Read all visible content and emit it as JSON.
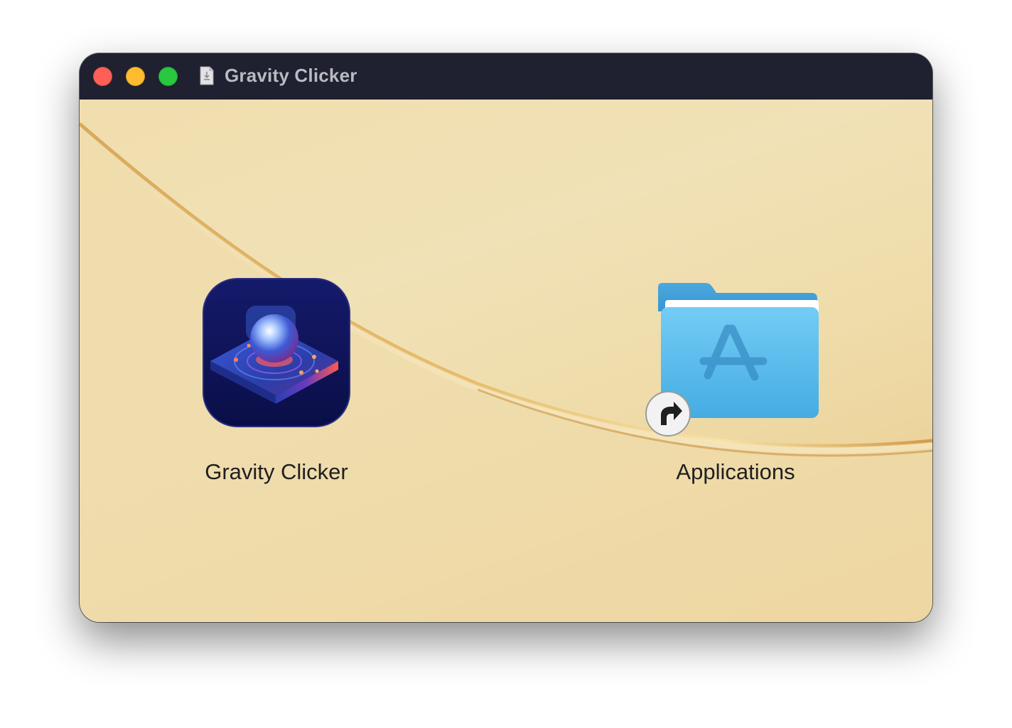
{
  "window": {
    "title": "Gravity Clicker",
    "controls": {
      "close_color": "#ff5f57",
      "minimize_color": "#febc2e",
      "zoom_color": "#28c840"
    },
    "titlebar_color": "#1f2030",
    "title_icon": "disk-image-icon"
  },
  "installer": {
    "items": [
      {
        "label": "Gravity Clicker",
        "icon": "gravity-clicker-app-icon"
      },
      {
        "label": "Applications",
        "icon": "applications-folder-icon",
        "badge": "alias-arrow-icon"
      }
    ]
  }
}
